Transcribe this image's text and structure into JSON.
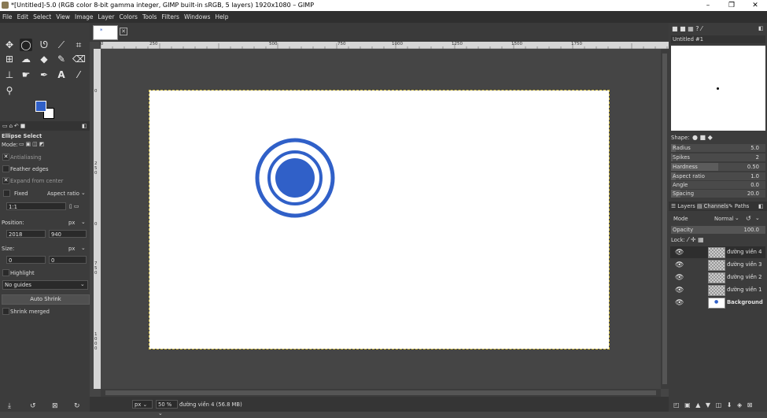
{
  "window": {
    "title": "*[Untitled]-5.0 (RGB color 8-bit gamma integer, GIMP built-in sRGB, 5 layers) 1920x1080 – GIMP",
    "minimize": "–",
    "maximize": "❐",
    "close": "✕"
  },
  "menu": [
    "File",
    "Edit",
    "Select",
    "View",
    "Image",
    "Layer",
    "Colors",
    "Tools",
    "Filters",
    "Windows",
    "Help"
  ],
  "tool_options": {
    "title": "Ellipse Select",
    "mode_label": "Mode:",
    "antialiasing": "Antialiasing",
    "feather_edges": "Feather edges",
    "expand_from_center": "Expand from center",
    "fixed_label": "Fixed",
    "fixed_dropdown": "Aspect ratio",
    "ratio_value": "1:1",
    "position_label": "Position:",
    "position_unit": "px",
    "position_x": "2018",
    "position_y": "940",
    "size_label": "Size:",
    "size_unit": "px",
    "size_w": "0",
    "size_h": "0",
    "highlight": "Highlight",
    "guides": "No guides",
    "auto_shrink": "Auto Shrink",
    "shrink_merged": "Shrink merged"
  },
  "ruler_h": [
    "|0",
    "250",
    "500",
    "750",
    "1000",
    "1250",
    "1500",
    "1750"
  ],
  "ruler_v": [
    "0",
    "2",
    "5",
    "0",
    "0",
    "7",
    "5",
    "0",
    "1",
    "0",
    "0",
    "0"
  ],
  "status": {
    "unit": "px",
    "zoom": "50 %",
    "layer_info": "đường viền 4 (56.8 MB)"
  },
  "brushes": {
    "title": "Untitled #1",
    "shape_label": "Shape:",
    "params": [
      {
        "label": "Radius",
        "value": "5.0",
        "fraction": 0.05
      },
      {
        "label": "Spikes",
        "value": "2",
        "fraction": 0.02
      },
      {
        "label": "Hardness",
        "value": "0.50",
        "fraction": 0.5
      },
      {
        "label": "Aspect ratio",
        "value": "1.0",
        "fraction": 0.05
      },
      {
        "label": "Angle",
        "value": "0.0",
        "fraction": 0.0
      },
      {
        "label": "Spacing",
        "value": "20.0",
        "fraction": 0.1
      }
    ]
  },
  "layers_panel": {
    "tab_layers": "Layers",
    "tab_channels": "Channels",
    "tab_paths": "Paths",
    "mode_label": "Mode",
    "mode_value": "Normal",
    "opacity_label": "Opacity",
    "opacity_value": "100.0",
    "lock_label": "Lock:",
    "layers": [
      {
        "name": "đường viền 4"
      },
      {
        "name": "đường viền 3"
      },
      {
        "name": "đường viền 2"
      },
      {
        "name": "đường viền 1"
      },
      {
        "name": "Background"
      }
    ]
  },
  "colors": {
    "foreground": "#3060c8",
    "background": "#ffffff",
    "circle": "#3060c8"
  }
}
